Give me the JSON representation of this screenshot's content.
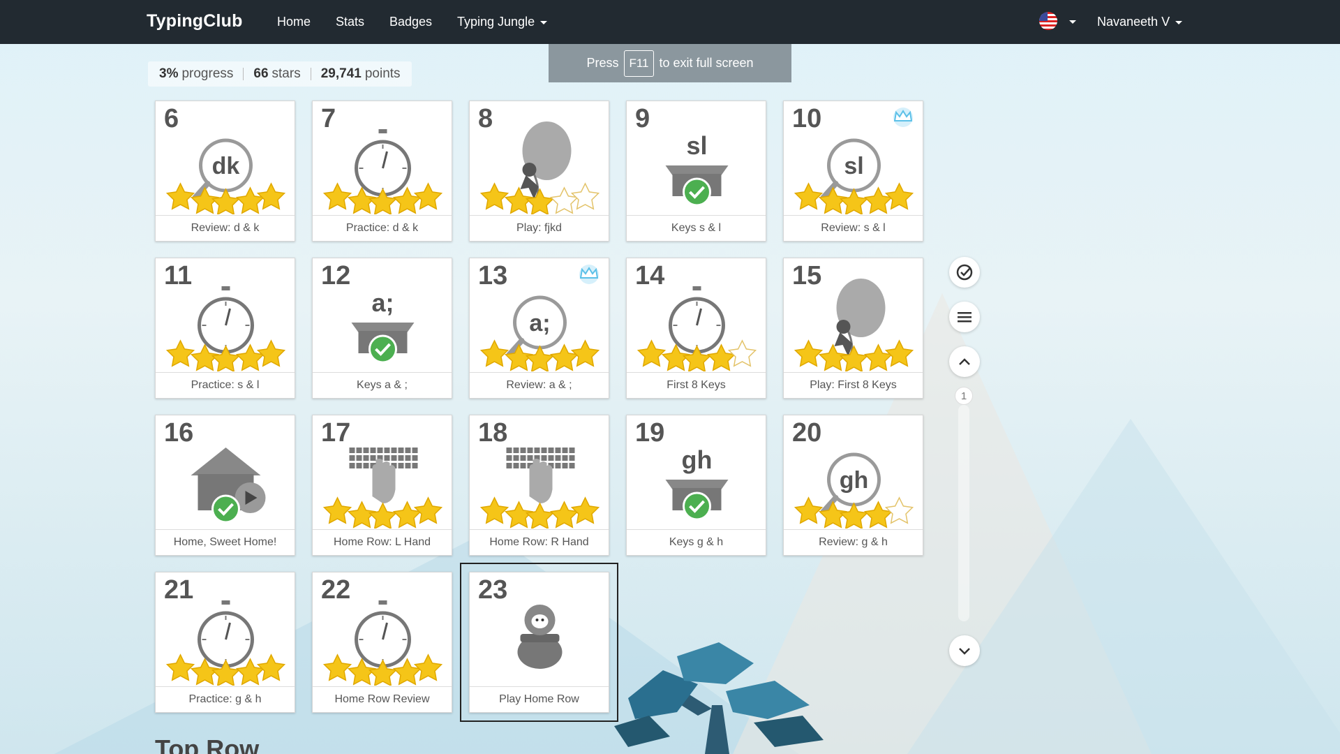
{
  "nav": {
    "brand": "TypingClub",
    "home": "Home",
    "stats": "Stats",
    "badges": "Badges",
    "jungle": "Typing Jungle",
    "user": "Navaneeth V"
  },
  "fullscreen": {
    "press": "Press",
    "key": "F11",
    "rest": "to exit full screen"
  },
  "progress": {
    "progress_value": "3%",
    "progress_label": "progress",
    "stars_value": "66",
    "stars_label": "stars",
    "points_value": "29,741",
    "points_label": "points"
  },
  "lessons": [
    {
      "num": "6",
      "label": "Review: d & k",
      "icon": "magnifier-dk-icon",
      "stars": 5,
      "badge": false
    },
    {
      "num": "7",
      "label": "Practice: d & k",
      "icon": "stopwatch-icon",
      "stars": 5,
      "badge": false
    },
    {
      "num": "8",
      "label": "Play: fjkd",
      "icon": "balloon-game-icon",
      "stars": 3,
      "badge": false
    },
    {
      "num": "9",
      "label": "Keys s & l",
      "icon": "box-sl-icon",
      "stars": 0,
      "badge": false
    },
    {
      "num": "10",
      "label": "Review: s & l",
      "icon": "magnifier-sl-icon",
      "stars": 5,
      "badge": true
    },
    {
      "num": "11",
      "label": "Practice: s & l",
      "icon": "stopwatch-icon",
      "stars": 5,
      "badge": false
    },
    {
      "num": "12",
      "label": "Keys a & ;",
      "icon": "box-a-icon",
      "stars": 0,
      "badge": false
    },
    {
      "num": "13",
      "label": "Review: a & ;",
      "icon": "magnifier-a-icon",
      "stars": 5,
      "badge": true
    },
    {
      "num": "14",
      "label": "First 8 Keys",
      "icon": "stopwatch-icon",
      "stars": 4,
      "badge": false
    },
    {
      "num": "15",
      "label": "Play: First 8 Keys",
      "icon": "balloon-game-icon",
      "stars": 5,
      "badge": false
    },
    {
      "num": "16",
      "label": "Home, Sweet Home!",
      "icon": "house-video-icon",
      "stars": 0,
      "badge": false
    },
    {
      "num": "17",
      "label": "Home Row: L Hand",
      "icon": "keyboard-hand-icon",
      "stars": 5,
      "badge": false
    },
    {
      "num": "18",
      "label": "Home Row: R Hand",
      "icon": "keyboard-hand-icon",
      "stars": 5,
      "badge": false
    },
    {
      "num": "19",
      "label": "Keys g & h",
      "icon": "box-gh-icon",
      "stars": 0,
      "badge": false
    },
    {
      "num": "20",
      "label": "Review: g & h",
      "icon": "magnifier-gh-icon",
      "stars": 4,
      "badge": false
    },
    {
      "num": "21",
      "label": "Practice: g & h",
      "icon": "stopwatch-icon",
      "stars": 5,
      "badge": false
    },
    {
      "num": "22",
      "label": "Home Row Review",
      "icon": "stopwatch-icon",
      "stars": 5,
      "badge": false
    },
    {
      "num": "23",
      "label": "Play Home Row",
      "icon": "pot-creature-icon",
      "stars": 0,
      "badge": false
    }
  ],
  "icon_text": {
    "dk": "dk",
    "sl": "sl",
    "a": "a;",
    "gh": "gh"
  },
  "pager": {
    "page": "1"
  },
  "next_section": "Top Row",
  "colors": {
    "nav_bg": "#222a31",
    "star": "#f5c518",
    "check": "#4caf50"
  }
}
